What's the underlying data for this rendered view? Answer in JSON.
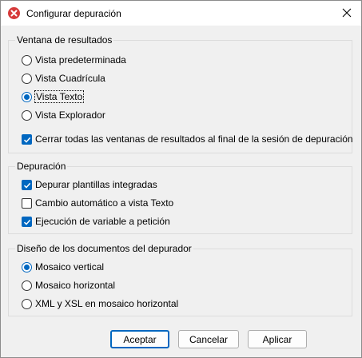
{
  "dialog": {
    "title": "Configurar depuración",
    "close_icon": "close-icon",
    "app_icon": "altova-app-icon"
  },
  "results_window": {
    "legend": "Ventana de resultados",
    "options": [
      {
        "label": "Vista predeterminada",
        "checked": false
      },
      {
        "label": "Vista Cuadrícula",
        "checked": false
      },
      {
        "label": "Vista Texto",
        "checked": true
      },
      {
        "label": "Vista Explorador",
        "checked": false
      }
    ],
    "close_all_label": "Cerrar todas las ventanas de resultados al final de la sesión de depuración",
    "close_all_checked": true
  },
  "debugging": {
    "legend": "Depuración",
    "options": [
      {
        "label": "Depurar plantillas integradas",
        "checked": true
      },
      {
        "label": "Cambio automático a vista Texto",
        "checked": false
      },
      {
        "label": "Ejecución de variable a petición",
        "checked": true
      }
    ]
  },
  "layout": {
    "legend": "Diseño de los documentos del depurador",
    "options": [
      {
        "label": "Mosaico vertical",
        "checked": true
      },
      {
        "label": "Mosaico horizontal",
        "checked": false
      },
      {
        "label": "XML y XSL en mosaico horizontal",
        "checked": false
      }
    ]
  },
  "buttons": {
    "accept": "Aceptar",
    "cancel": "Cancelar",
    "apply": "Aplicar"
  },
  "colors": {
    "accent": "#0067c0",
    "app_icon": "#d63a3a"
  }
}
